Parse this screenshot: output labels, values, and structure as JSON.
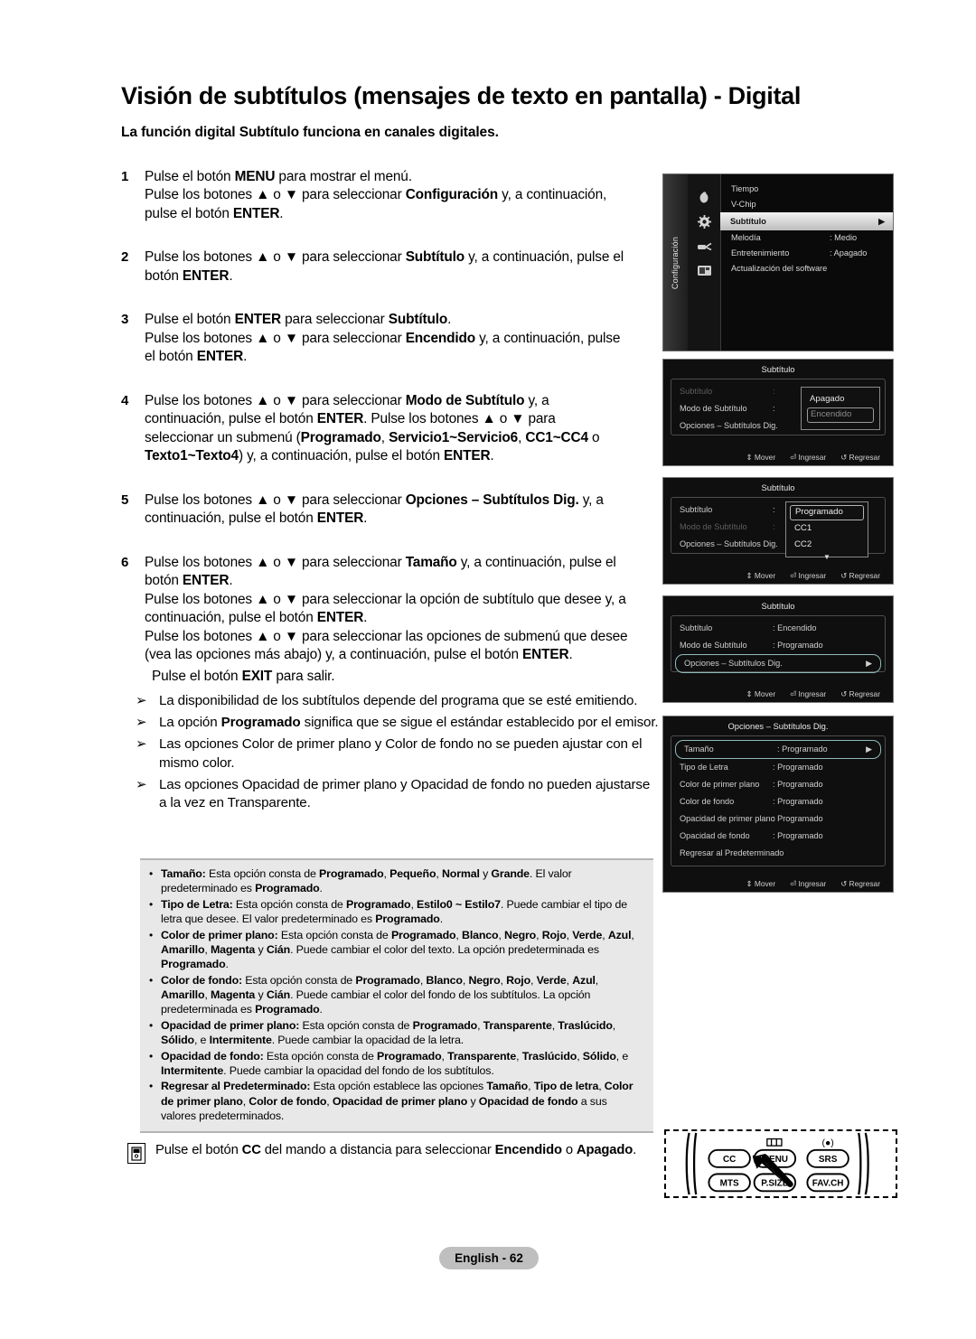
{
  "document": {
    "title": "Visión de subtítulos (mensajes de texto en pantalla) - Digital",
    "subtitle": "La función digital Subtítulo funciona en canales digitales.",
    "footer_label": "English - 62"
  },
  "steps": [
    {
      "number": "1",
      "lines": [
        "Pulse el botón <b>MENU</b> para mostrar el menú.",
        "Pulse los botones ▲ o ▼ para seleccionar <b>Configuración</b> y, a continuación,",
        "pulse el botón <b>ENTER</b>."
      ]
    },
    {
      "number": "2",
      "lines": [
        "Pulse los botones ▲ o ▼ para seleccionar <b>Subtítulo</b> y, a continuación, pulse el",
        "botón <b>ENTER</b>."
      ]
    },
    {
      "number": "3",
      "lines": [
        "Pulse el botón <b>ENTER</b> para seleccionar <b>Subtítulo</b>.",
        "Pulse los botones ▲ o ▼ para seleccionar <b>Encendido</b> y, a continuación, pulse",
        "el botón <b>ENTER</b>."
      ]
    },
    {
      "number": "4",
      "lines": [
        "Pulse los botones ▲ o ▼ para seleccionar <b>Modo de Subtítulo</b> y, a",
        "continuación, pulse el botón <b>ENTER</b>.  Pulse los botones ▲ o ▼ para",
        "seleccionar un submenú (<b>Programado</b>, <b>Servicio1~Servicio6</b>, <b>CC1~CC4</b> o",
        "<b>Texto1~Texto4</b>) y, a continuación, pulse el botón <b>ENTER</b>."
      ]
    },
    {
      "number": "5",
      "lines": [
        "Pulse los botones ▲ o ▼ para seleccionar <b>Opciones – Subtítulos Dig.</b> y, a",
        "continuación, pulse el botón <b>ENTER</b>."
      ]
    },
    {
      "number": "6",
      "lines": [
        "Pulse los botones ▲ o ▼ para seleccionar <b>Tamaño</b> y, a continuación, pulse el",
        "botón <b>ENTER</b>.",
        "Pulse los botones ▲ o ▼ para seleccionar la opción de subtítulo que desee y, a",
        "continuación, pulse el botón <b>ENTER</b>.",
        "Pulse los botones ▲ o ▼ para seleccionar las opciones de submenú que desee",
        "(vea las opciones más abajo) y, a continuación, pulse el botón <b>ENTER</b>."
      ]
    }
  ],
  "exit_line": "Pulse el botón <b>EXIT</b> para salir.",
  "notes": {
    "marker": "➢",
    "items": [
      "La disponibilidad de los subtítulos depende del programa que se esté emitiendo.",
      "La opción <b>Programado</b> significa que se sigue el estándar establecido por el emisor.",
      "Las opciones Color de primer plano y Color de fondo no se pueden ajustar con el mismo color.",
      "Las opciones Opacidad de primer plano y Opacidad de fondo no pueden ajustarse a la vez en Transparente."
    ]
  },
  "options_box": {
    "marker": "•",
    "items": [
      "<b>Tamaño:</b> Esta opción consta de <b>Programado</b>, <b>Pequeño</b>, <b>Normal</b> y <b>Grande</b>. El valor predeterminado es <b>Programado</b>.",
      "<b>Tipo de Letra:</b> Esta opción consta de <b>Programado</b>, <b>Estilo0 ~ Estilo7</b>. Puede cambiar el tipo de letra que desee. El valor predeterminado es <b>Programado</b>.",
      "<b>Color de primer plano:</b> Esta opción consta de <b>Programado</b>, <b>Blanco</b>, <b>Negro</b>, <b>Rojo</b>, <b>Verde</b>, <b>Azul</b>, <b>Amarillo</b>, <b>Magenta</b> y <b>Cián</b>. Puede cambiar el color del texto. La opción predeterminada es <b>Programado</b>.",
      "<b>Color de fondo:</b> Esta opción consta de <b>Programado</b>, <b>Blanco</b>, <b>Negro</b>, <b>Rojo</b>, <b>Verde</b>, <b>Azul</b>, <b>Amarillo</b>, <b>Magenta</b> y <b>Cián</b>. Puede cambiar el color del fondo de los subtítulos. La opción predeterminada es <b>Programado</b>.",
      "<b>Opacidad de primer plano:</b> Esta opción consta de <b>Programado</b>, <b>Transparente</b>, <b>Traslúcido</b>, <b>Sólido</b>, e <b>Intermitente</b>. Puede cambiar la opacidad de la letra.",
      "<b>Opacidad de fondo:</b> Esta opción consta de <b>Programado</b>, <b>Transparente</b>, <b>Traslúcido</b>, <b>Sólido</b>, e <b>Intermitente</b>. Puede cambiar la opacidad del fondo de los subtítulos.",
      "<b>Regresar al Predeterminado:</b> Esta opción establece las opciones <b>Tamaño</b>, <b>Tipo de letra</b>, <b>Color de primer plano</b>, <b>Color de fondo</b>, <b>Opacidad de primer plano</b> y <b>Opacidad de fondo</b> a sus valores predeterminados."
    ]
  },
  "remote_note": {
    "text": "Pulse el botón <b>CC</b> del mando a distancia para seleccionar <b>Encendido</b> o <b>Apagado</b>."
  },
  "remote_illustration": {
    "buttons": [
      "CC",
      "MENU",
      "SRS",
      "MTS",
      "P.SIZE",
      "FAV.CH"
    ]
  },
  "tv_menus": {
    "panel1": {
      "tab_label": "Configuración",
      "rows": [
        {
          "label": "Tiempo",
          "value": "",
          "selected": false
        },
        {
          "label": "V-Chip",
          "value": "",
          "selected": false
        },
        {
          "label": "Subtítulo",
          "value": "",
          "selected": true,
          "arrow": "▶"
        },
        {
          "label": "Melodía",
          "value": ": Medio",
          "selected": false
        },
        {
          "label": "Entretenimiento",
          "value": ": Apagado",
          "selected": false
        },
        {
          "label": "Actualización del software",
          "value": "",
          "selected": false
        }
      ]
    },
    "panel2": {
      "title": "Subtítulo",
      "rows": [
        {
          "label": "Subtítulo",
          "value": ":",
          "dim": true
        },
        {
          "label": "Modo de Subtítulo",
          "value": ":",
          "dim": false
        },
        {
          "label": "Opciones – Subtítulos Dig.",
          "value": "",
          "dim": false
        }
      ],
      "dropdown": [
        {
          "label": "Apagado",
          "highlighted": false
        },
        {
          "label": "Encendido",
          "highlighted": true
        }
      ],
      "footer": [
        "⇕ Mover",
        "⏎ Ingresar",
        "↺ Regresar"
      ]
    },
    "panel3": {
      "title": "Subtítulo",
      "rows": [
        {
          "label": "Subtítulo",
          "value": ":",
          "dim": false
        },
        {
          "label": "Modo de Subtítulo",
          "value": ":",
          "dim": true
        },
        {
          "label": "Opciones – Subtítulos Dig.",
          "value": "",
          "dim": false
        }
      ],
      "dropdown": [
        {
          "label": "Programado",
          "highlighted": true
        },
        {
          "label": "CC1",
          "highlighted": false
        },
        {
          "label": "CC2",
          "highlighted": false
        }
      ],
      "dropdown_caret": "▼",
      "footer": [
        "⇕ Mover",
        "⏎ Ingresar",
        "↺ Regresar"
      ]
    },
    "panel4": {
      "title": "Subtítulo",
      "rows": [
        {
          "label": "Subtítulo",
          "value": ": Encendido",
          "selected": false
        },
        {
          "label": "Modo de Subtítulo",
          "value": ": Programado",
          "selected": false
        },
        {
          "label": "Opciones – Subtítulos Dig.",
          "value": "",
          "selected": true,
          "arrow": "▶"
        }
      ],
      "footer": [
        "⇕ Mover",
        "⏎ Ingresar",
        "↺ Regresar"
      ]
    },
    "panel5": {
      "title": "Opciones – Subtítulos Dig.",
      "rows": [
        {
          "label": "Tamaño",
          "value": ": Programado",
          "selected": true,
          "arrow": "▶"
        },
        {
          "label": "Tipo de Letra",
          "value": ": Programado",
          "selected": false
        },
        {
          "label": "Color de primer plano",
          "value": ": Programado",
          "selected": false
        },
        {
          "label": "Color de fondo",
          "value": ": Programado",
          "selected": false
        },
        {
          "label": "Opacidad de primer plano",
          "value": ": Programado",
          "selected": false
        },
        {
          "label": "Opacidad de fondo",
          "value": ": Programado",
          "selected": false
        },
        {
          "label": "Regresar al Predeterminado",
          "value": "",
          "selected": false
        }
      ],
      "footer": [
        "⇕ Mover",
        "⏎ Ingresar",
        "↺ Regresar"
      ]
    }
  }
}
